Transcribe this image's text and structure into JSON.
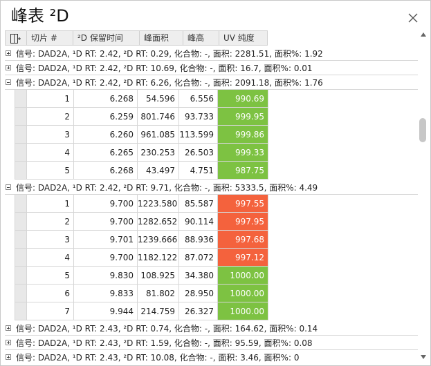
{
  "window": {
    "title": "峰表 ²D"
  },
  "header": {
    "columns": [
      "切片 #",
      "²D 保留时间",
      "峰面积",
      "峰高",
      "UV 纯度"
    ]
  },
  "groups": [
    {
      "label": "信号: DAD2A, ¹D RT: 2.42, ²D RT: 0.29, 化合物: -, 面积: 2281.51, 面积%: 1.92",
      "expanded": false
    },
    {
      "label": "信号: DAD2A, ¹D RT: 2.42, ²D RT: 10.69, 化合物: -, 面积: 16.7, 面积%: 0.01",
      "expanded": false
    },
    {
      "label": "信号: DAD2A, ¹D RT: 2.42, ²D RT: 6.26, 化合物: -, 面积: 2091.18, 面积%: 1.76",
      "expanded": true,
      "rows": [
        {
          "slice": "1",
          "rt": "6.268",
          "area": "54.596",
          "height": "6.556",
          "purity": "990.69",
          "status": "green"
        },
        {
          "slice": "2",
          "rt": "6.259",
          "area": "801.746",
          "height": "93.733",
          "purity": "999.95",
          "status": "green"
        },
        {
          "slice": "3",
          "rt": "6.260",
          "area": "961.085",
          "height": "113.599",
          "purity": "999.86",
          "status": "green"
        },
        {
          "slice": "4",
          "rt": "6.265",
          "area": "230.253",
          "height": "26.503",
          "purity": "999.33",
          "status": "green"
        },
        {
          "slice": "5",
          "rt": "6.268",
          "area": "43.497",
          "height": "4.751",
          "purity": "987.75",
          "status": "green"
        }
      ]
    },
    {
      "label": "信号: DAD2A, ¹D RT: 2.42, ²D RT: 9.71, 化合物: -, 面积: 5333.5, 面积%: 4.49",
      "expanded": true,
      "rows": [
        {
          "slice": "1",
          "rt": "9.700",
          "area": "1223.580",
          "height": "85.587",
          "purity": "997.55",
          "status": "red"
        },
        {
          "slice": "2",
          "rt": "9.700",
          "area": "1282.652",
          "height": "90.114",
          "purity": "997.95",
          "status": "red"
        },
        {
          "slice": "3",
          "rt": "9.701",
          "area": "1239.666",
          "height": "88.936",
          "purity": "997.68",
          "status": "red"
        },
        {
          "slice": "4",
          "rt": "9.700",
          "area": "1182.122",
          "height": "87.072",
          "purity": "997.12",
          "status": "red"
        },
        {
          "slice": "5",
          "rt": "9.830",
          "area": "108.925",
          "height": "34.380",
          "purity": "1000.00",
          "status": "green"
        },
        {
          "slice": "6",
          "rt": "9.833",
          "area": "81.802",
          "height": "28.950",
          "purity": "1000.00",
          "status": "green"
        },
        {
          "slice": "7",
          "rt": "9.944",
          "area": "214.759",
          "height": "26.327",
          "purity": "1000.00",
          "status": "green"
        }
      ]
    },
    {
      "label": "信号: DAD2A, ¹D RT: 2.43, ²D RT: 0.74, 化合物: -, 面积: 164.62, 面积%: 0.14",
      "expanded": false
    },
    {
      "label": "信号: DAD2A, ¹D RT: 2.43, ²D RT: 1.59, 化合物: -, 面积: 95.59, 面积%: 0.08",
      "expanded": false
    },
    {
      "label": "信号: DAD2A, ¹D RT: 2.43, ²D RT: 10.08, 化合物: -, 面积: 3.46, 面积%: 0",
      "expanded": false
    }
  ],
  "colors": {
    "green": "#7dc242",
    "red": "#f4623d"
  },
  "icons": {
    "close": "close-icon",
    "column_chooser": "column-chooser-icon",
    "expand": "plus-box-icon",
    "collapse": "minus-box-icon"
  }
}
